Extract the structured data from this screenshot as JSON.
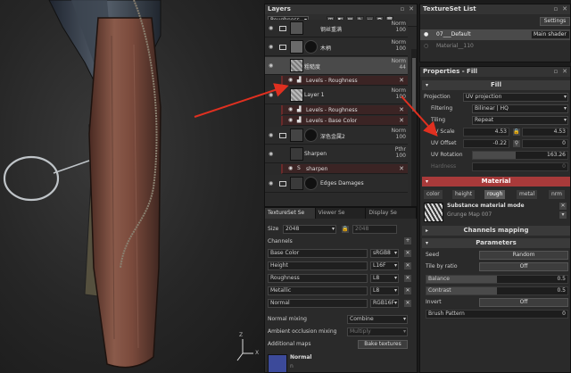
{
  "viewport": {
    "axis_z": "Z",
    "axis_x": "X"
  },
  "layers": {
    "title": "Layers",
    "channel_dropdown": "Roughness",
    "rows": [
      {
        "name": "钢丝重满",
        "blend": "Norm",
        "opacity": "100"
      },
      {
        "name": "木柄",
        "blend": "Norm",
        "opacity": "100"
      },
      {
        "name": "粗糙度",
        "blend": "Norm",
        "opacity": "44"
      },
      {
        "name": "Layer 1",
        "blend": "Norm",
        "opacity": "100"
      },
      {
        "name": "深色金属2",
        "blend": "Norm",
        "opacity": "100"
      },
      {
        "name": "Sharpen",
        "blend": "Pthr",
        "opacity": "100"
      },
      {
        "name": "Edges Damages",
        "blend": "Norm",
        "opacity": ""
      }
    ],
    "effects": {
      "levels_roughness_1": "Levels - Roughness",
      "levels_roughness_2": "Levels - Roughness",
      "levels_base_color": "Levels - Base Color",
      "sharpen": "sharpen"
    }
  },
  "texture_set_settings": {
    "tabs": [
      "TextureSet Se",
      "Viewer Se",
      "Display Se"
    ],
    "size_label": "Size",
    "size_value": "2048",
    "size_link_value": "2048",
    "channels_label": "Channels",
    "channels": [
      {
        "name": "Base Color",
        "format": "sRGB8"
      },
      {
        "name": "Height",
        "format": "L16F"
      },
      {
        "name": "Roughness",
        "format": "L8"
      },
      {
        "name": "Metallic",
        "format": "L8"
      },
      {
        "name": "Normal",
        "format": "RGB16F"
      }
    ],
    "normal_mixing_label": "Normal mixing",
    "normal_mixing_value": "Combine",
    "ao_mixing_label": "Ambient occlusion mixing",
    "ao_mixing_value": "Multiply",
    "additional_maps_label": "Additional maps",
    "bake_button": "Bake textures",
    "normal_map_label": "Normal",
    "normal_map_sub": "n"
  },
  "texture_set_list": {
    "title": "TextureSet List",
    "settings_button": "Settings",
    "items": [
      {
        "name": "07___Default",
        "shader": "Main shader"
      },
      {
        "name": "Material__110",
        "shader": ""
      }
    ]
  },
  "properties": {
    "title": "Properties - Fill",
    "fill_section": "Fill",
    "projection_label": "Projection",
    "projection_value": "UV projection",
    "filtering_label": "Filtering",
    "filtering_value": "Bilinear | HQ",
    "tiling_label": "Tiling",
    "tiling_value": "Repeat",
    "uv_scale_label": "UV Scale",
    "uv_scale_a": "4.53",
    "uv_scale_b": "4.53",
    "uv_offset_label": "UV Offset",
    "uv_offset_a": "-0.22",
    "uv_offset_b": "0",
    "uv_rotation_label": "UV Rotation",
    "uv_rotation_value": "163.26",
    "uv_rotation_fraction": 0.45,
    "hardness_label": "Hardness",
    "hardness_value": "0",
    "material_section": "Material",
    "channel_tabs": [
      "color",
      "height",
      "rough",
      "metal",
      "nrm"
    ],
    "substance_title": "Substance material mode",
    "substance_name": "Grunge Map 007",
    "channels_mapping": "Channels mapping",
    "parameters": "Parameters",
    "seed_label": "Seed",
    "seed_value": "Random",
    "tile_label": "Tile by ratio",
    "tile_value": "Off",
    "balance_label": "Balance",
    "balance_value": "0.5",
    "balance_fraction": 0.5,
    "contrast_label": "Contrast",
    "contrast_value": "0.5",
    "contrast_fraction": 0.5,
    "invert_label": "Invert",
    "invert_value": "Off",
    "brush_label": "Brush Pattern",
    "brush_value": "0",
    "brush_fraction": 0.0
  },
  "colors": {
    "accent_red": "#a83a3a",
    "arrow_red": "#e03020",
    "panel_bg": "#2a2a2a"
  }
}
